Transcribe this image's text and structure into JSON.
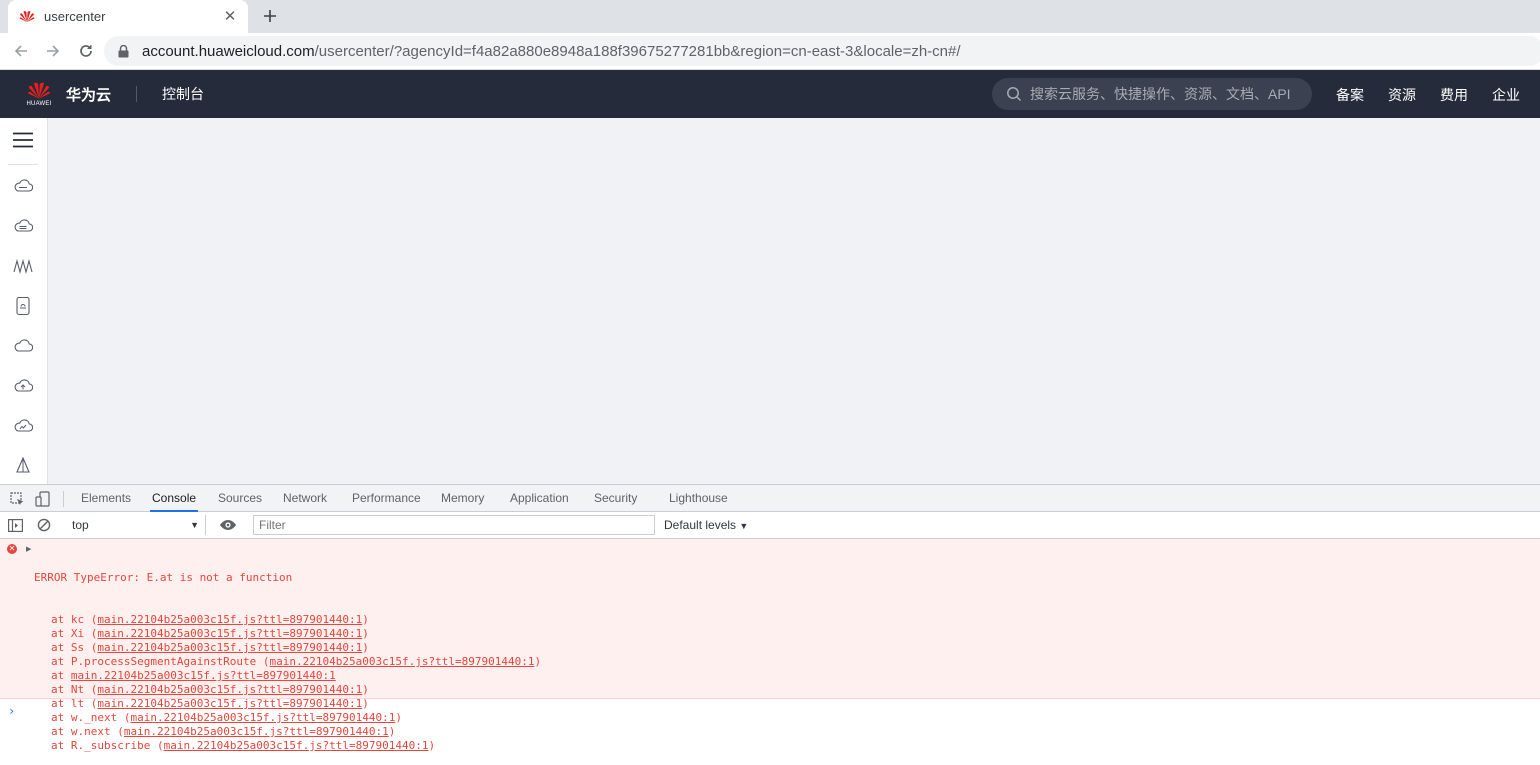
{
  "browser": {
    "tab_title": "usercenter",
    "url_host": "account.huaweicloud.com",
    "url_path": "/usercenter/?agencyId=f4a82a880e8948a188f39675277281bb&region=cn-east-3&locale=zh-cn#/"
  },
  "header": {
    "logo_word": "HUAWEI",
    "brand": "华为云",
    "console": "控制台",
    "search_placeholder": "搜索云服务、快捷操作、资源、文档、API",
    "nav": [
      "备案",
      "资源",
      "费用",
      "企业"
    ]
  },
  "sidebar": {
    "icons": [
      "cloud-server-icon",
      "database-icon",
      "network-icon",
      "storage-icon",
      "cloud-icon",
      "cloud-upload-icon",
      "cloud-monitor-icon",
      "deploy-icon"
    ]
  },
  "devtools": {
    "tabs": [
      "Elements",
      "Console",
      "Sources",
      "Network",
      "Performance",
      "Memory",
      "Application",
      "Security",
      "Lighthouse"
    ],
    "active_tab": "Console",
    "context": "top",
    "filter_placeholder": "Filter",
    "levels": "Default levels",
    "error": {
      "message": "ERROR TypeError: E.at is not a function",
      "stack": [
        {
          "fn": "at kc (",
          "src": "main.22104b25a003c15f.js?ttl=897901440:1",
          "end": ")"
        },
        {
          "fn": "at Xi (",
          "src": "main.22104b25a003c15f.js?ttl=897901440:1",
          "end": ")"
        },
        {
          "fn": "at Ss (",
          "src": "main.22104b25a003c15f.js?ttl=897901440:1",
          "end": ")"
        },
        {
          "fn": "at P.processSegmentAgainstRoute (",
          "src": "main.22104b25a003c15f.js?ttl=897901440:1",
          "end": ")"
        },
        {
          "fn": "at ",
          "src": "main.22104b25a003c15f.js?ttl=897901440:1",
          "end": ""
        },
        {
          "fn": "at Nt (",
          "src": "main.22104b25a003c15f.js?ttl=897901440:1",
          "end": ")"
        },
        {
          "fn": "at lt (",
          "src": "main.22104b25a003c15f.js?ttl=897901440:1",
          "end": ")"
        },
        {
          "fn": "at w._next (",
          "src": "main.22104b25a003c15f.js?ttl=897901440:1",
          "end": ")"
        },
        {
          "fn": "at w.next (",
          "src": "main.22104b25a003c15f.js?ttl=897901440:1",
          "end": ")"
        },
        {
          "fn": "at R._subscribe (",
          "src": "main.22104b25a003c15f.js?ttl=897901440:1",
          "end": ")"
        }
      ]
    },
    "prompt": "›"
  }
}
